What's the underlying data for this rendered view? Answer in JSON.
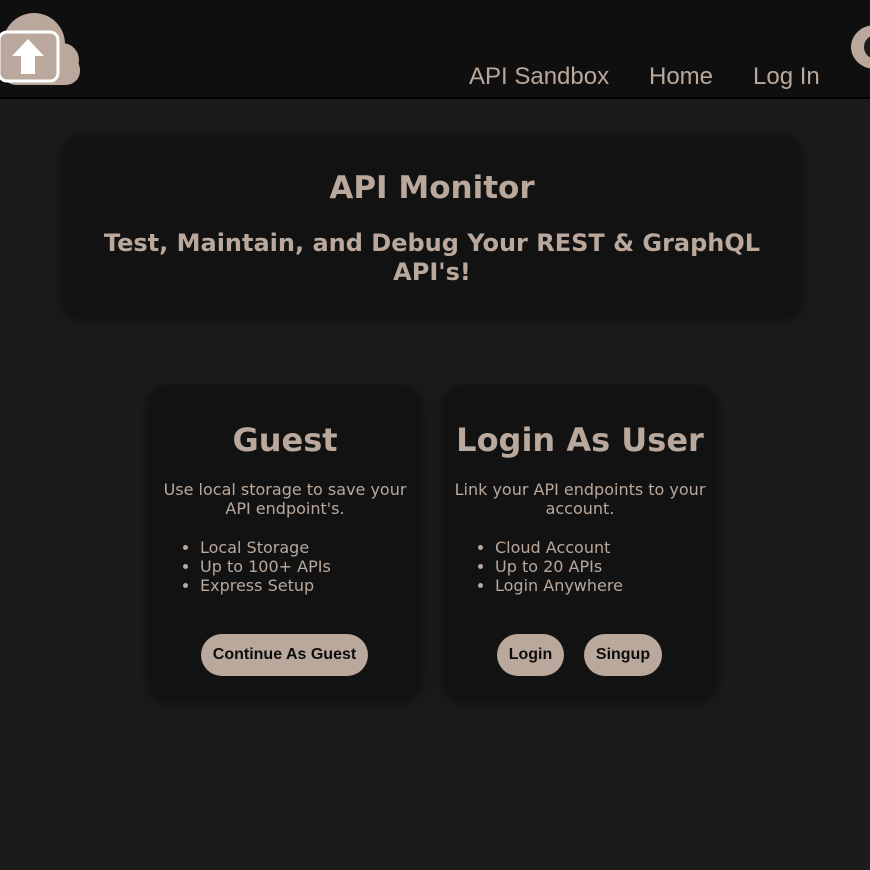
{
  "colors": {
    "background": "#1b1b1b",
    "navbar": "#0f0f0f",
    "card": "#121212",
    "accent": "#b9a89b",
    "button_text": "#0d0d0d"
  },
  "header": {
    "logo_icon": "cloud-upload-icon",
    "nav": {
      "sandbox": "API Sandbox",
      "home": "Home",
      "login": "Log In"
    },
    "toggle_icon": "theme-toggle-icon"
  },
  "hero": {
    "title": "API Monitor",
    "subtitle": "Test, Maintain, and Debug Your REST & GraphQL API's!"
  },
  "guest_card": {
    "title": "Guest",
    "description": "Use local storage to save your API endpoint's.",
    "features": [
      "Local Storage",
      "Up to 100+ APIs",
      "Express Setup"
    ],
    "button": "Continue As Guest"
  },
  "user_card": {
    "title": "Login As User",
    "description": "Link your API endpoints to your account.",
    "features": [
      "Cloud Account",
      "Up to 20 APIs",
      "Login Anywhere"
    ],
    "login_button": "Login",
    "signup_button": "Singup"
  }
}
